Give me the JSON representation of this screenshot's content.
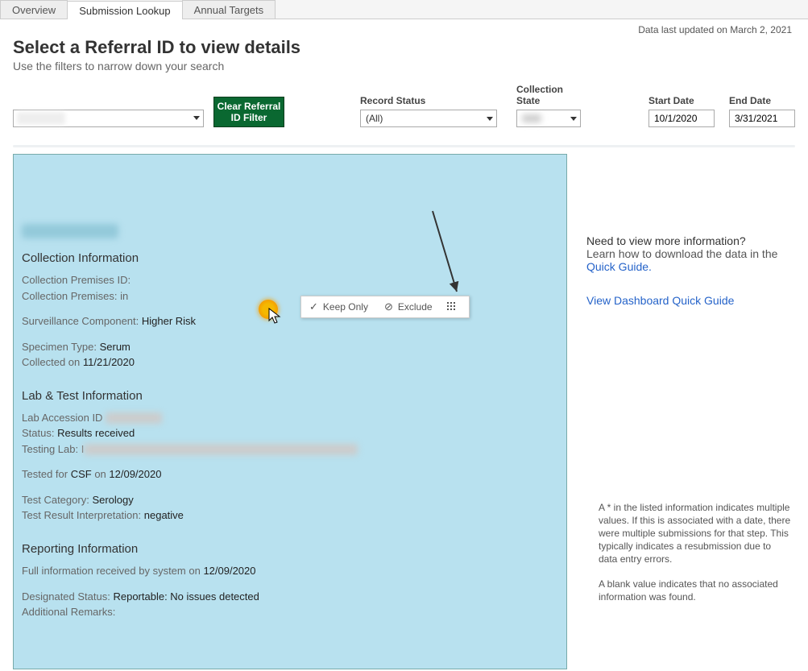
{
  "tabs": {
    "overview": "Overview",
    "submission_lookup": "Submission Lookup",
    "annual_targets": "Annual Targets"
  },
  "updated_text": "Data last updated on March 2, 2021",
  "heading": {
    "title": "Select a Referral ID to view details",
    "subtitle": "Use the filters to narrow down your search"
  },
  "filters": {
    "clear_button_line1": "Clear Referral",
    "clear_button_line2": "ID Filter",
    "record_status_label": "Record Status",
    "record_status_value": "(All)",
    "collection_state_label": "Collection State",
    "collection_state_value": "",
    "start_date_label": "Start Date",
    "start_date_value": "10/1/2020",
    "end_date_label": "End Date",
    "end_date_value": "3/31/2021"
  },
  "detail": {
    "collection_heading": "Collection Information",
    "coll_prem_id_label": "Collection Premises ID:",
    "coll_prem_label": "Collection Premises:  in",
    "surv_label": "Surveillance Component: ",
    "surv_value": "Higher Risk",
    "spec_label": "Specimen Type: ",
    "spec_value": "Serum",
    "collected_label": "Collected on ",
    "collected_value": "11/21/2020",
    "lab_heading": "Lab & Test Information",
    "accession_label": "Lab Accession ID",
    "status_label": "Status: ",
    "status_value": "Results received",
    "testing_lab_label": "Testing Lab: I",
    "tested_for_label": "Tested for ",
    "tested_for_value": "CSF",
    "tested_on_label": " on ",
    "tested_on_value": "12/09/2020",
    "cat_label": "Test Category: ",
    "cat_value": "Serology",
    "interp_label": "Test Result Interpretation: ",
    "interp_value": "negative",
    "report_heading": "Reporting Information",
    "full_label": "Full information received by system on ",
    "full_value": "12/09/2020",
    "desig_label": "Designated Status: ",
    "desig_value": "Reportable: No issues detected",
    "remarks_label": "Additional Remarks:"
  },
  "tooltip": {
    "keep": "Keep Only",
    "exclude": "Exclude"
  },
  "side": {
    "need_title": "Need to view more information?",
    "need_body_prefix": "Learn how to download the data in the ",
    "need_link": "Quick Guide.",
    "view_link": "View Dashboard Quick Guide",
    "footnote1": "A * in the listed information indicates multiple values. If this is associated with a date, there were multiple submissions for that step. This typically indicates a resubmission due to data entry errors.",
    "footnote2": "A blank value indicates that no associated information was found."
  }
}
